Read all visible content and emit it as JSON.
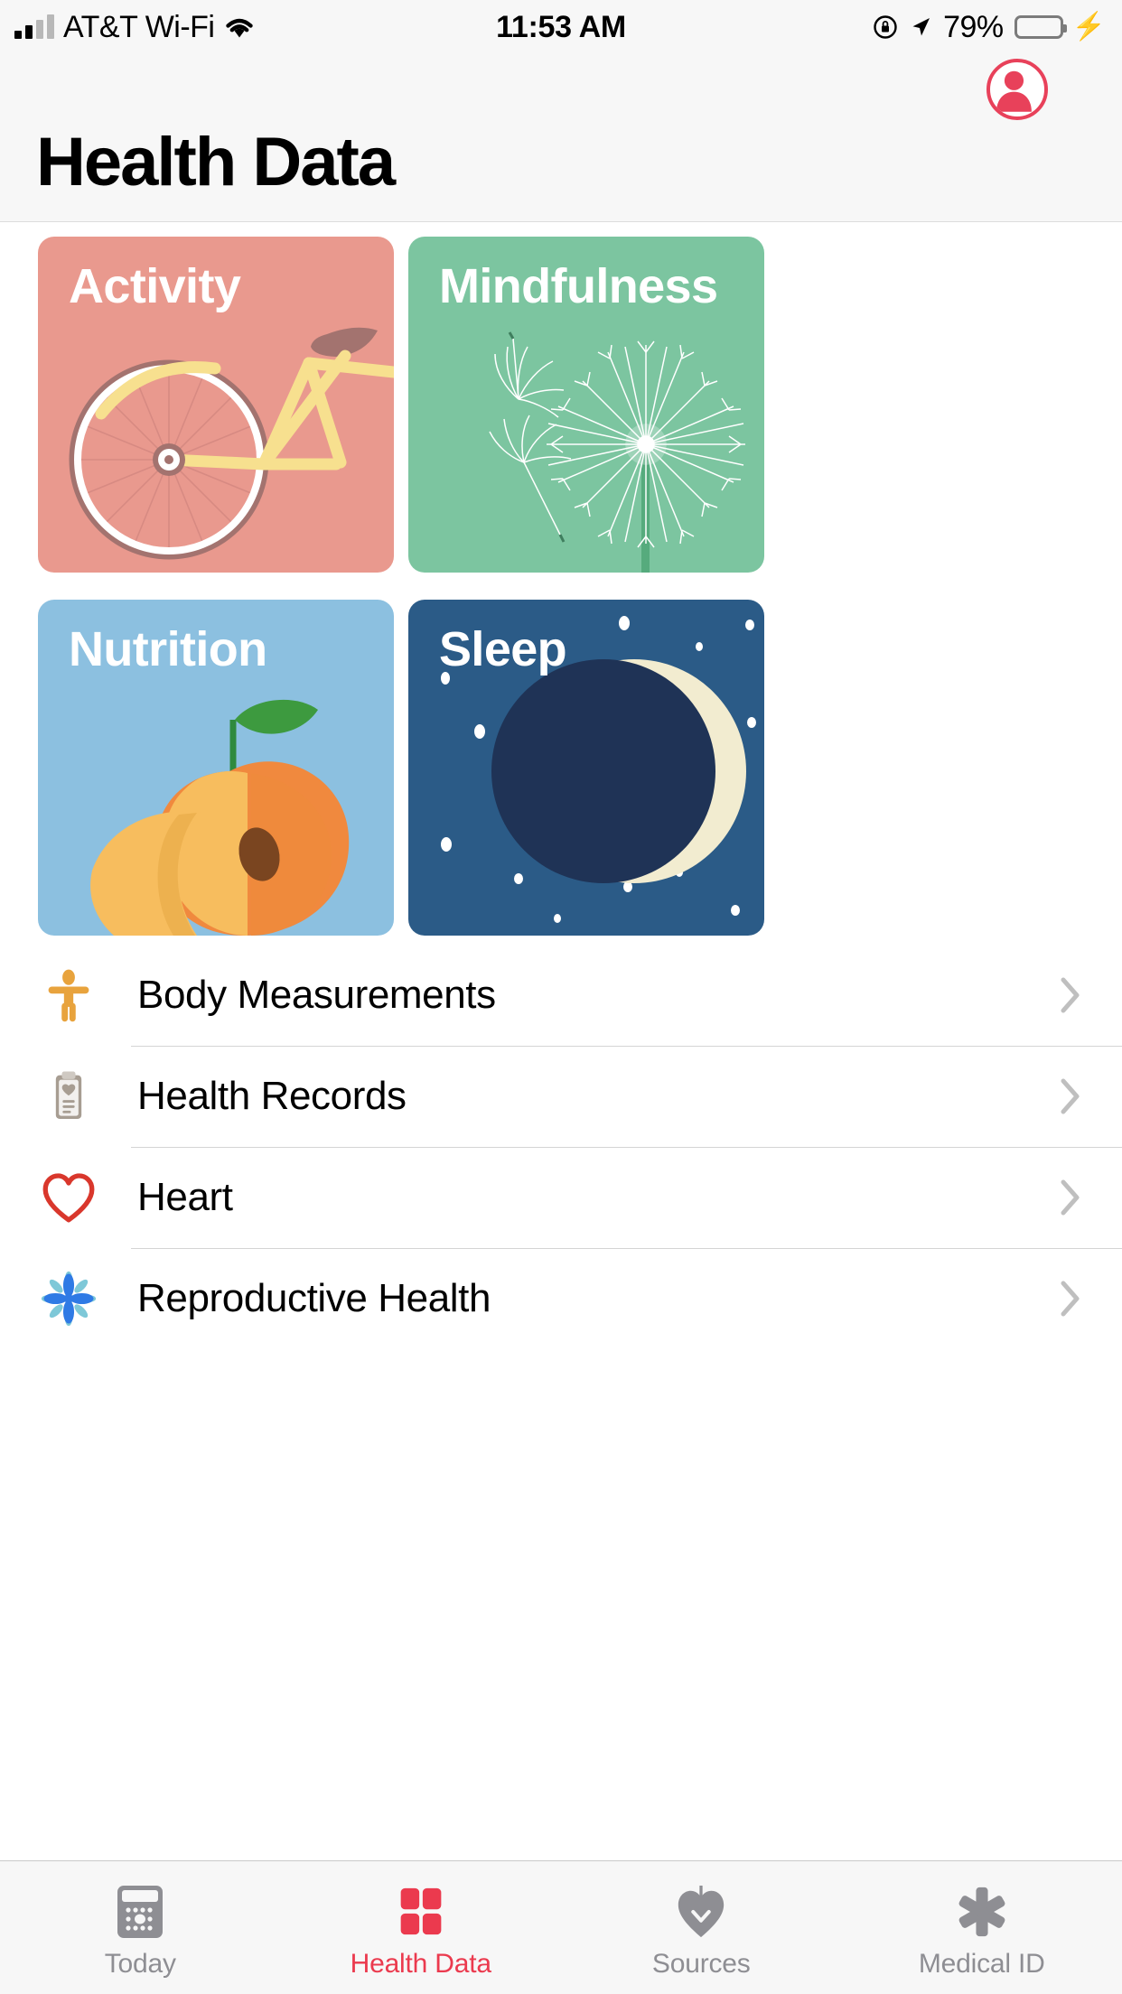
{
  "statusbar": {
    "carrier": "AT&T Wi-Fi",
    "time": "11:53 AM",
    "battery_percent": "79%",
    "signal_icon": "signal-bars-icon",
    "wifi_icon": "wifi-icon",
    "rotation_lock_icon": "rotation-lock-icon",
    "location_icon": "location-arrow-icon",
    "battery_icon": "battery-icon",
    "charging_icon": "charging-bolt-icon"
  },
  "header": {
    "title": "Health Data",
    "avatar_icon": "profile-avatar-icon",
    "avatar_color": "#e8415a"
  },
  "cards": [
    {
      "label": "Activity",
      "bg": "#e9998e",
      "art": "bicycle-illustration"
    },
    {
      "label": "Mindfulness",
      "bg": "#7cc5a0",
      "art": "dandelion-illustration"
    },
    {
      "label": "Nutrition",
      "bg": "#8cc0e0",
      "art": "peach-illustration"
    },
    {
      "label": "Sleep",
      "bg": "#2b5b87",
      "art": "moon-and-stars-illustration"
    }
  ],
  "list": [
    {
      "label": "Body Measurements",
      "icon": "body-measurements-icon",
      "icon_color": "#e8a33d"
    },
    {
      "label": "Health Records",
      "icon": "clipboard-icon",
      "icon_color": "#a79d92"
    },
    {
      "label": "Heart",
      "icon": "heart-icon",
      "icon_color": "#d9372c"
    },
    {
      "label": "Reproductive Health",
      "icon": "flower-icon",
      "icon_color": "#2f7ae5"
    }
  ],
  "tabs": [
    {
      "label": "Today",
      "icon": "calendar-icon",
      "active": false
    },
    {
      "label": "Health Data",
      "icon": "health-data-icon",
      "active": true
    },
    {
      "label": "Sources",
      "icon": "sources-icon",
      "active": false
    },
    {
      "label": "Medical ID",
      "icon": "medical-id-icon",
      "active": false
    }
  ],
  "colors": {
    "accent": "#eb3a4e",
    "inactive": "#8e8e93"
  }
}
